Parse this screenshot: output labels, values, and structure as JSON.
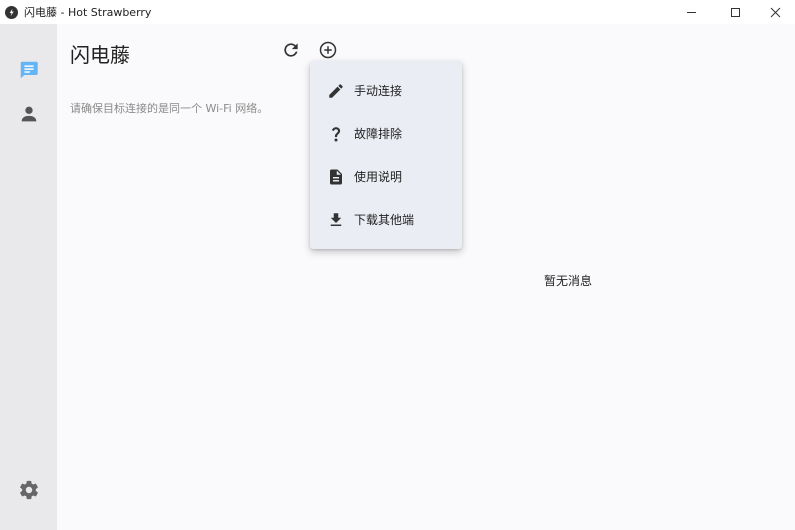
{
  "window": {
    "title": "闪电藤 - Hot Strawberry",
    "app_icon": "lightning-vine-logo-icon",
    "controls": [
      "minimize-icon",
      "maximize-icon",
      "close-icon"
    ]
  },
  "sidebar": {
    "items": [
      {
        "name": "messages",
        "icon": "chat-icon",
        "active": true,
        "color": "#64b5f6"
      },
      {
        "name": "contacts",
        "icon": "person-icon",
        "active": false,
        "color": "#555555"
      }
    ],
    "bottom": {
      "name": "settings",
      "icon": "gear-icon",
      "color": "#555555"
    }
  },
  "main": {
    "title": "闪电藤",
    "toolbar": {
      "refresh_icon": "refresh-icon",
      "add_icon": "add-circle-icon"
    },
    "hint": "请确保目标连接的是同一个 Wi-Fi 网络。",
    "empty_text": "暂无消息"
  },
  "menu": {
    "items": [
      {
        "label": "手动连接",
        "icon": "pencil-icon"
      },
      {
        "label": "故障排除",
        "icon": "question-icon"
      },
      {
        "label": "使用说明",
        "icon": "document-icon"
      },
      {
        "label": "下载其他端",
        "icon": "download-icon"
      }
    ]
  },
  "colors": {
    "sidebar_bg": "#e9e9eb",
    "main_bg": "#fafafc",
    "menu_bg": "#eaedf4",
    "accent": "#64b5f6"
  }
}
